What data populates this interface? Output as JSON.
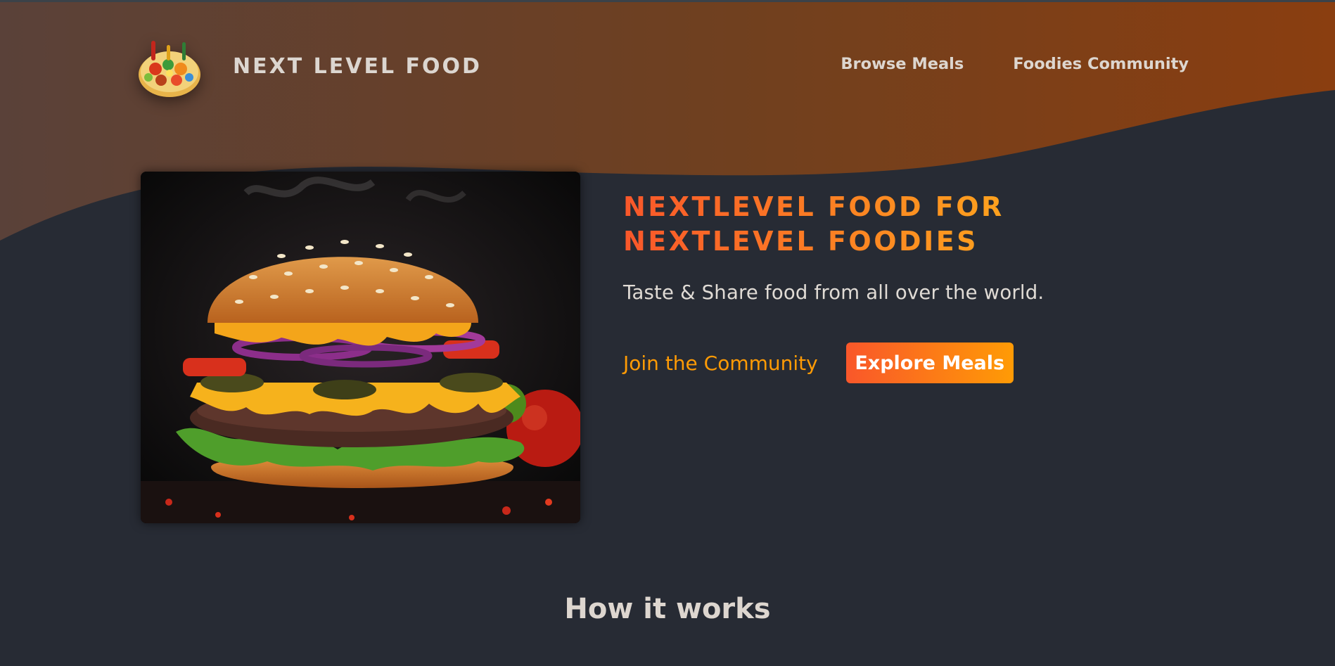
{
  "header": {
    "brand": "NEXT LEVEL FOOD",
    "logo_icon": "food-platter-icon",
    "nav": [
      {
        "label": "Browse Meals"
      },
      {
        "label": "Foodies Community"
      }
    ]
  },
  "hero": {
    "image_icon": "burger-image",
    "title_line1": "NEXTLEVEL FOOD FOR",
    "title_line2": "NEXTLEVEL FOODIES",
    "subtitle": "Taste & Share food from all over the world.",
    "join_label": "Join the Community",
    "explore_label": "Explore Meals"
  },
  "section": {
    "how_title": "How it works"
  },
  "colors": {
    "background": "#272b34",
    "wave_start": "#5a4139",
    "wave_end": "#8a3e10",
    "accent_orange": "#f9572a",
    "accent_amber": "#ff9b05",
    "text_light": "#ddd6cf"
  }
}
